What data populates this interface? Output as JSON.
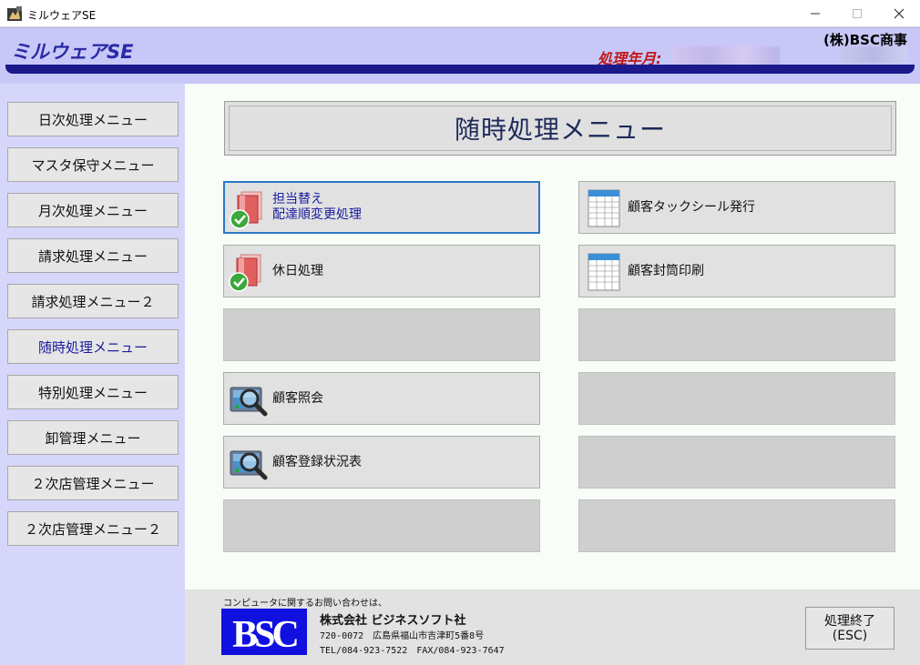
{
  "window": {
    "title": "ミルウェアSE"
  },
  "header": {
    "brand": "ミルウェアSE",
    "period_label": "処理年月:",
    "company": "(株)BSC商事"
  },
  "sidebar": {
    "items": [
      {
        "label": "日次処理メニュー"
      },
      {
        "label": "マスタ保守メニュー"
      },
      {
        "label": "月次処理メニュー"
      },
      {
        "label": "請求処理メニュー"
      },
      {
        "label": "請求処理メニュー２"
      },
      {
        "label": "随時処理メニュー",
        "active": true
      },
      {
        "label": "特別処理メニュー"
      },
      {
        "label": "卸管理メニュー"
      },
      {
        "label": "２次店管理メニュー"
      },
      {
        "label": "２次店管理メニュー２"
      }
    ]
  },
  "main": {
    "title": "随時処理メニュー",
    "left_buttons": [
      {
        "line1": "担当替え",
        "line2": "配達順変更処理",
        "icon": "document-check-icon"
      },
      {
        "line1": "休日処理",
        "line2": "",
        "icon": "document-check-icon"
      },
      {
        "line1": "",
        "line2": "",
        "icon": ""
      },
      {
        "line1": "顧客照会",
        "line2": "",
        "icon": "magnifier-screen-icon"
      },
      {
        "line1": "顧客登録状況表",
        "line2": "",
        "icon": "magnifier-screen-icon"
      },
      {
        "line1": "",
        "line2": "",
        "icon": ""
      }
    ],
    "right_buttons": [
      {
        "line1": "顧客タックシール発行",
        "icon": "spreadsheet-icon"
      },
      {
        "line1": "顧客封筒印刷",
        "icon": "spreadsheet-icon"
      },
      {
        "line1": "",
        "icon": ""
      },
      {
        "line1": "",
        "icon": ""
      },
      {
        "line1": "",
        "icon": ""
      },
      {
        "line1": "",
        "icon": ""
      }
    ]
  },
  "footer": {
    "contact": "コンピュータに関するお問い合わせは、",
    "logo": "BSC",
    "corp_name": "株式会社 ビジネスソフト社",
    "address": "720-0072　広島県福山市吉津町5番8号",
    "tel": "TEL/084-923-7522　FAX/084-923-7647",
    "exit_line1": "処理終了",
    "exit_line2": "(ESC)"
  },
  "colors": {
    "header_bg": "#c8c8f8",
    "stripe": "#1a1a8c",
    "sidebar_bg": "#d6d6fa",
    "brand_text": "#2a2aa6",
    "period_text": "#c01818",
    "logo_bg": "#1010e0"
  }
}
